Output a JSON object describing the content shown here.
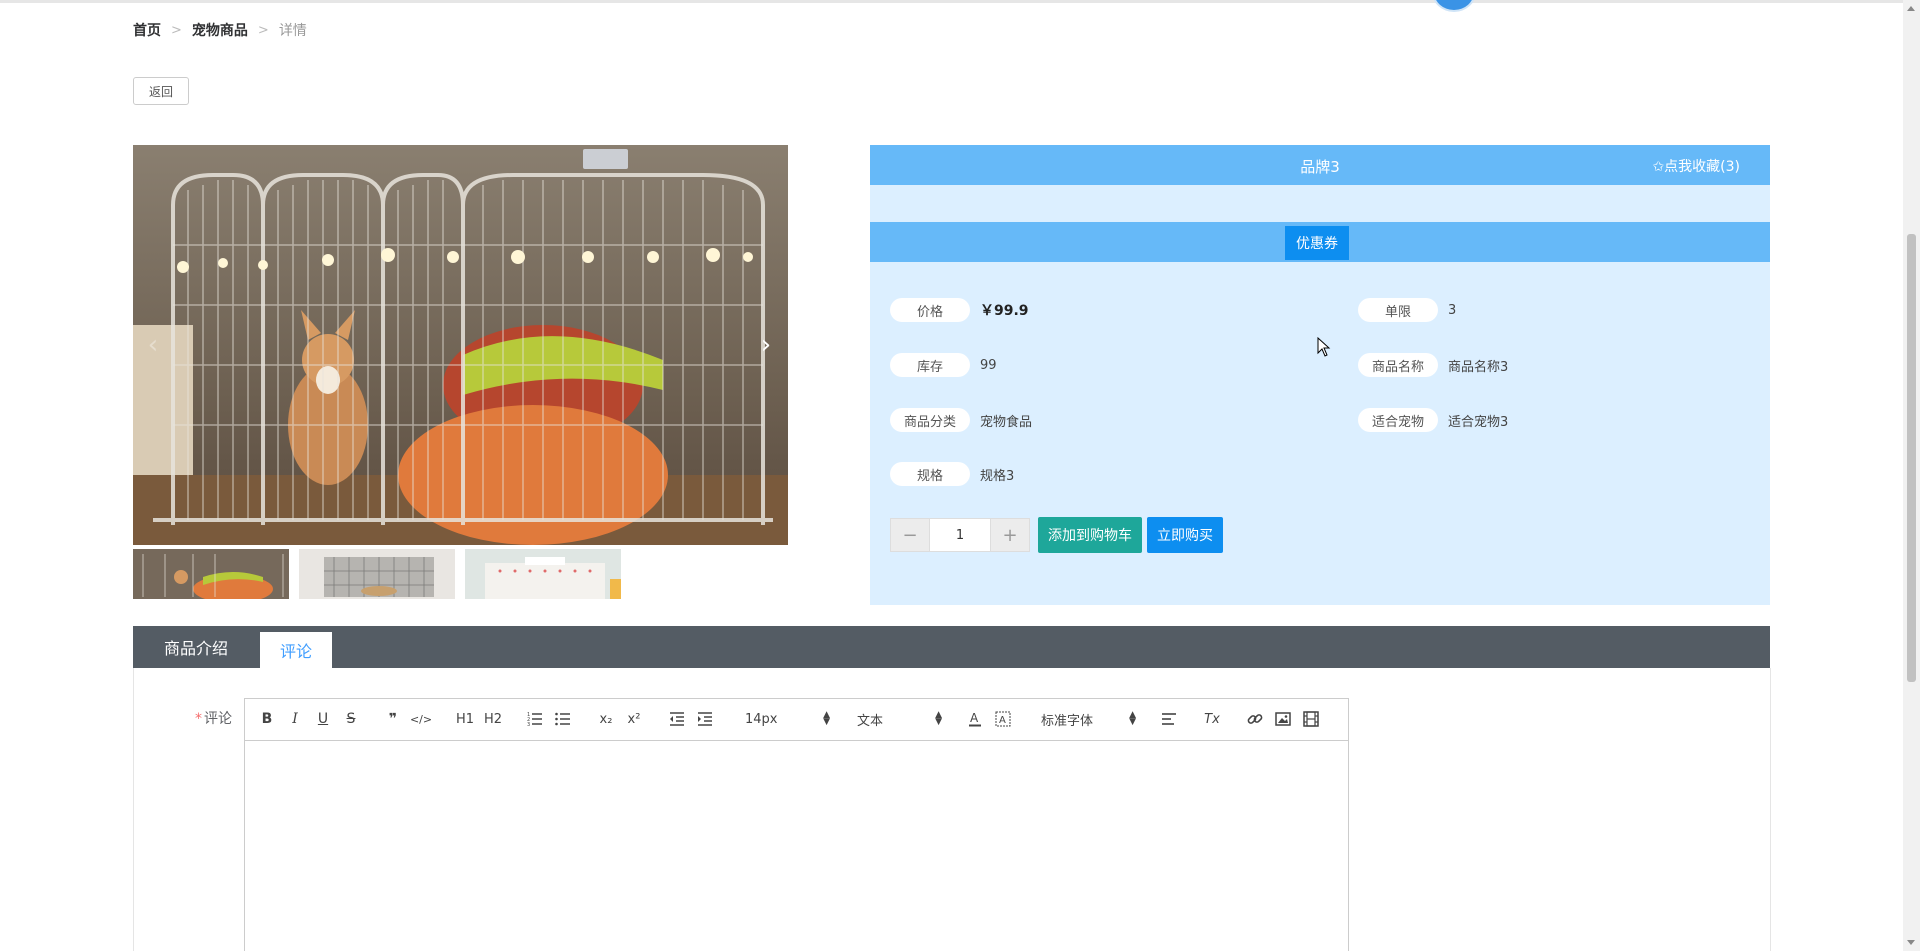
{
  "breadcrumb": {
    "home": "首页",
    "category": "宠物商品",
    "current": "详情",
    "separator": ">"
  },
  "back_label": "返回",
  "product": {
    "brand": "品牌3",
    "favorite": "✩点我收藏(3)",
    "coupon_label": "优惠券",
    "fields": {
      "price": {
        "label": "价格",
        "value": "￥99.9"
      },
      "limit": {
        "label": "单限",
        "value": "3"
      },
      "stock": {
        "label": "库存",
        "value": "99"
      },
      "name": {
        "label": "商品名称",
        "value": "商品名称3"
      },
      "category": {
        "label": "商品分类",
        "value": "宠物食品"
      },
      "suitable": {
        "label": "适合宠物",
        "value": "适合宠物3"
      },
      "spec": {
        "label": "规格",
        "value": "规格3"
      }
    },
    "quantity": "1",
    "minus": "−",
    "plus": "+",
    "add_to_cart": "添加到购物车",
    "buy_now": "立即购买"
  },
  "gallery": {
    "prev": "‹",
    "next": "›",
    "thumb_count": 3
  },
  "tabs": {
    "intro": "商品介绍",
    "comments": "评论"
  },
  "comment": {
    "label": "评论",
    "required_mark": "*",
    "toolbar": {
      "bold": "B",
      "italic": "I",
      "underline": "U",
      "strike": "S",
      "blockquote": "❞",
      "code": "</>",
      "h1": "H1",
      "h2": "H2",
      "sub": "x₂",
      "sup": "x²",
      "size": "14px",
      "header": "文本",
      "font": "标准字体",
      "clean": "Tx"
    }
  },
  "colors": {
    "accent_blue": "#66b9f8",
    "panel_bg": "#dcefff",
    "cart_green": "#1ea79a",
    "buy_blue": "#0d8ef0",
    "tab_bg": "#545c64"
  }
}
